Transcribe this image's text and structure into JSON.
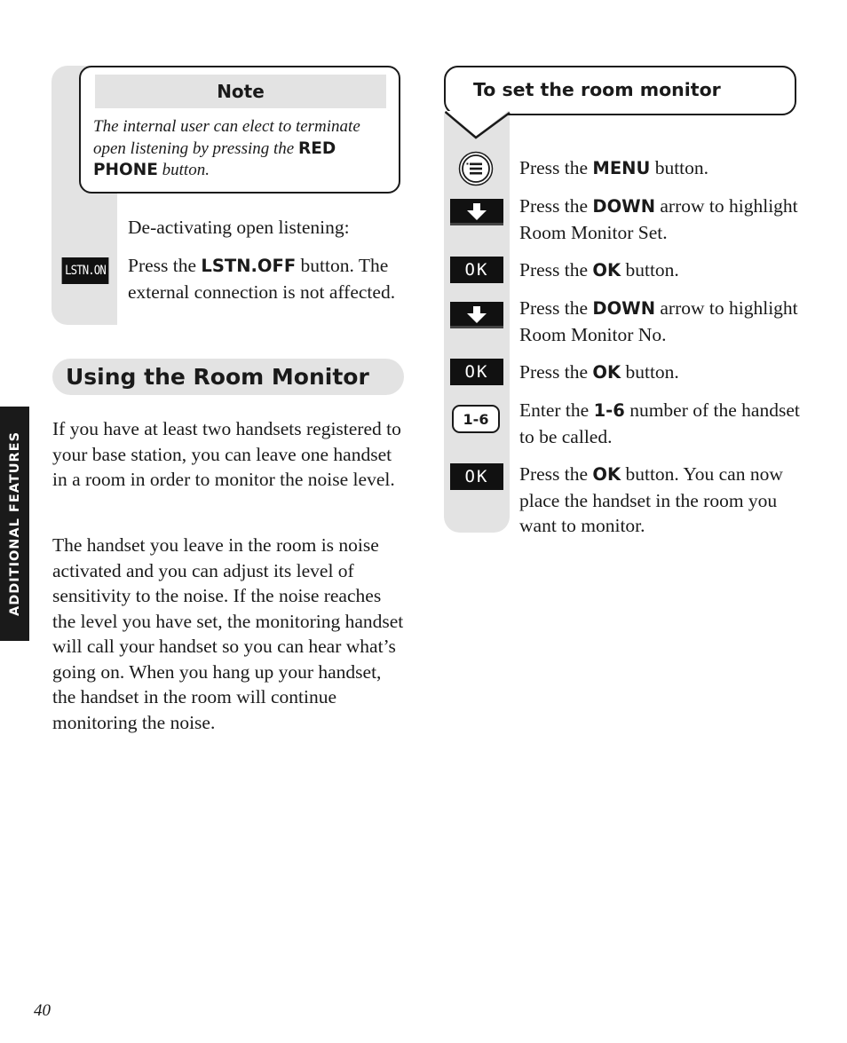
{
  "note": {
    "title": "Note",
    "text_1": "The internal user can elect to terminate open listening by pressing the ",
    "text_bold": "RED PHONE",
    "text_2": " button."
  },
  "deactivate": {
    "heading": "De-activating open listening:",
    "icon_label": "LSTN.ON",
    "text_1": "Press the ",
    "text_bold": "LSTN.OFF",
    "text_2": " button. The external connection is not affected."
  },
  "section": {
    "title": "Using the Room Monitor",
    "paragraphs": [
      "If you have at least two handsets registered to your base station, you can leave one handset in a room in order to monitor the noise level.",
      "The handset you leave in the room is noise activated and you can adjust its level of sensitivity to the noise. If the noise reaches the level you have set, the monitoring handset will call your handset so you can hear what’s going on. When you hang up your handset, the handset in the room will continue monitoring the noise."
    ]
  },
  "side_tab": "ADDITIONAL FEATURES",
  "page_number": "40",
  "procedure": {
    "title": "To set the room monitor",
    "steps": [
      {
        "icon": "menu-button-icon",
        "pre": "Press the ",
        "bold": "MENU",
        "post": " button."
      },
      {
        "icon": "down-arrow-icon",
        "pre": "Press the ",
        "bold": "DOWN",
        "post": " arrow to highlight Room Monitor Set."
      },
      {
        "icon": "ok-key-icon",
        "icon_label": "OK",
        "pre": "Press the ",
        "bold": "OK",
        "post": " button."
      },
      {
        "icon": "down-arrow-icon",
        "pre": "Press the ",
        "bold": "DOWN",
        "post": " arrow to highlight Room Monitor No."
      },
      {
        "icon": "ok-key-icon",
        "icon_label": "OK",
        "pre": "Press the ",
        "bold": "OK",
        "post": " button."
      },
      {
        "icon": "number-key-icon",
        "icon_label": "1-6",
        "pre": "Enter the ",
        "bold": "1-6",
        "post": " number of the handset to be called."
      },
      {
        "icon": "ok-key-icon",
        "icon_label": "OK",
        "pre": "Press the ",
        "bold": "OK",
        "post": " button. You can now place the handset in the room you want to monitor."
      }
    ]
  }
}
